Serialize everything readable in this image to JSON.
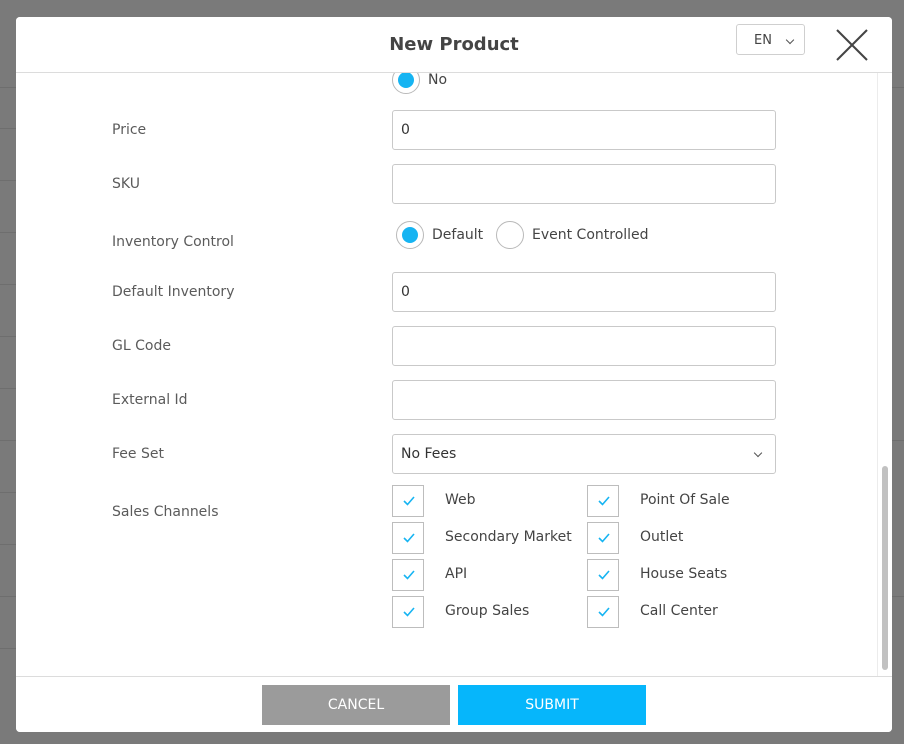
{
  "modal": {
    "title": "New Product",
    "language": "EN"
  },
  "form": {
    "taxable_option_no": "No",
    "price": {
      "label": "Price",
      "value": "0"
    },
    "sku": {
      "label": "SKU",
      "value": ""
    },
    "inventory_control": {
      "label": "Inventory Control",
      "options": [
        "Default",
        "Event Controlled"
      ],
      "selected": "Default"
    },
    "default_inventory": {
      "label": "Default Inventory",
      "value": "0"
    },
    "gl_code": {
      "label": "GL Code",
      "value": ""
    },
    "external_id": {
      "label": "External Id",
      "value": ""
    },
    "fee_set": {
      "label": "Fee Set",
      "value": "No Fees"
    },
    "sales_channels": {
      "label": "Sales Channels",
      "items": [
        {
          "label": "Web",
          "checked": true
        },
        {
          "label": "Point Of Sale",
          "checked": true
        },
        {
          "label": "Secondary Market",
          "checked": true
        },
        {
          "label": "Outlet",
          "checked": true
        },
        {
          "label": "API",
          "checked": true
        },
        {
          "label": "House Seats",
          "checked": true
        },
        {
          "label": "Group Sales",
          "checked": true
        },
        {
          "label": "Call Center",
          "checked": true
        }
      ]
    }
  },
  "footer": {
    "cancel_label": "CANCEL",
    "submit_label": "SUBMIT"
  },
  "colors": {
    "accent": "#06b6fb",
    "radio_fill": "#16b4f2",
    "cancel_button": "#9b9b9b",
    "backdrop": "#7a7a7a"
  }
}
